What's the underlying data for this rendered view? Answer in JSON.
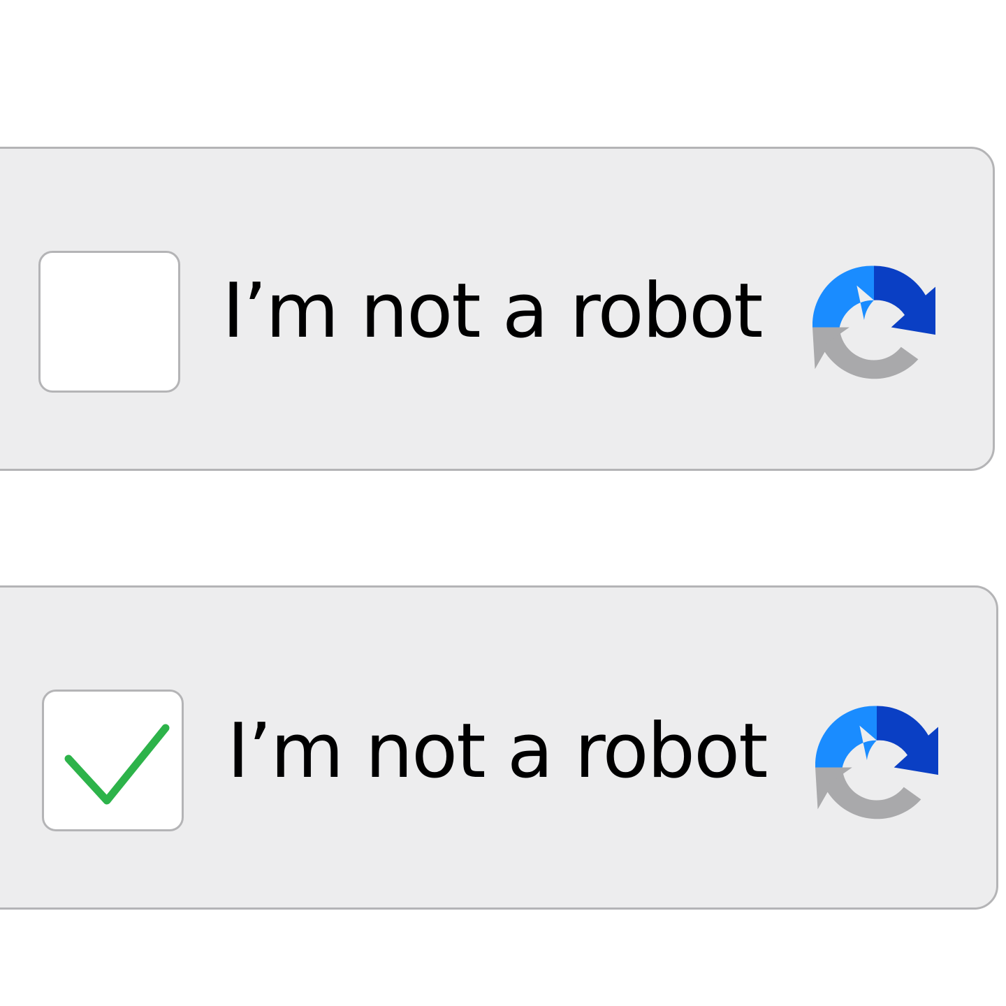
{
  "widgets": [
    {
      "label": "I’m not a robot",
      "checked": false,
      "logo_icon": "recaptcha-logo-icon"
    },
    {
      "label": "I’m not a robot",
      "checked": true,
      "logo_icon": "recaptcha-logo-icon",
      "checkmark_icon": "checkmark-icon",
      "checkmark_color": "#2db34a"
    }
  ],
  "colors": {
    "widget_background": "#ededee",
    "widget_border": "#b4b4b6",
    "logo_light_blue": "#1a8cff",
    "logo_dark_blue": "#0a3fc4",
    "logo_gray": "#a9a9ab"
  }
}
